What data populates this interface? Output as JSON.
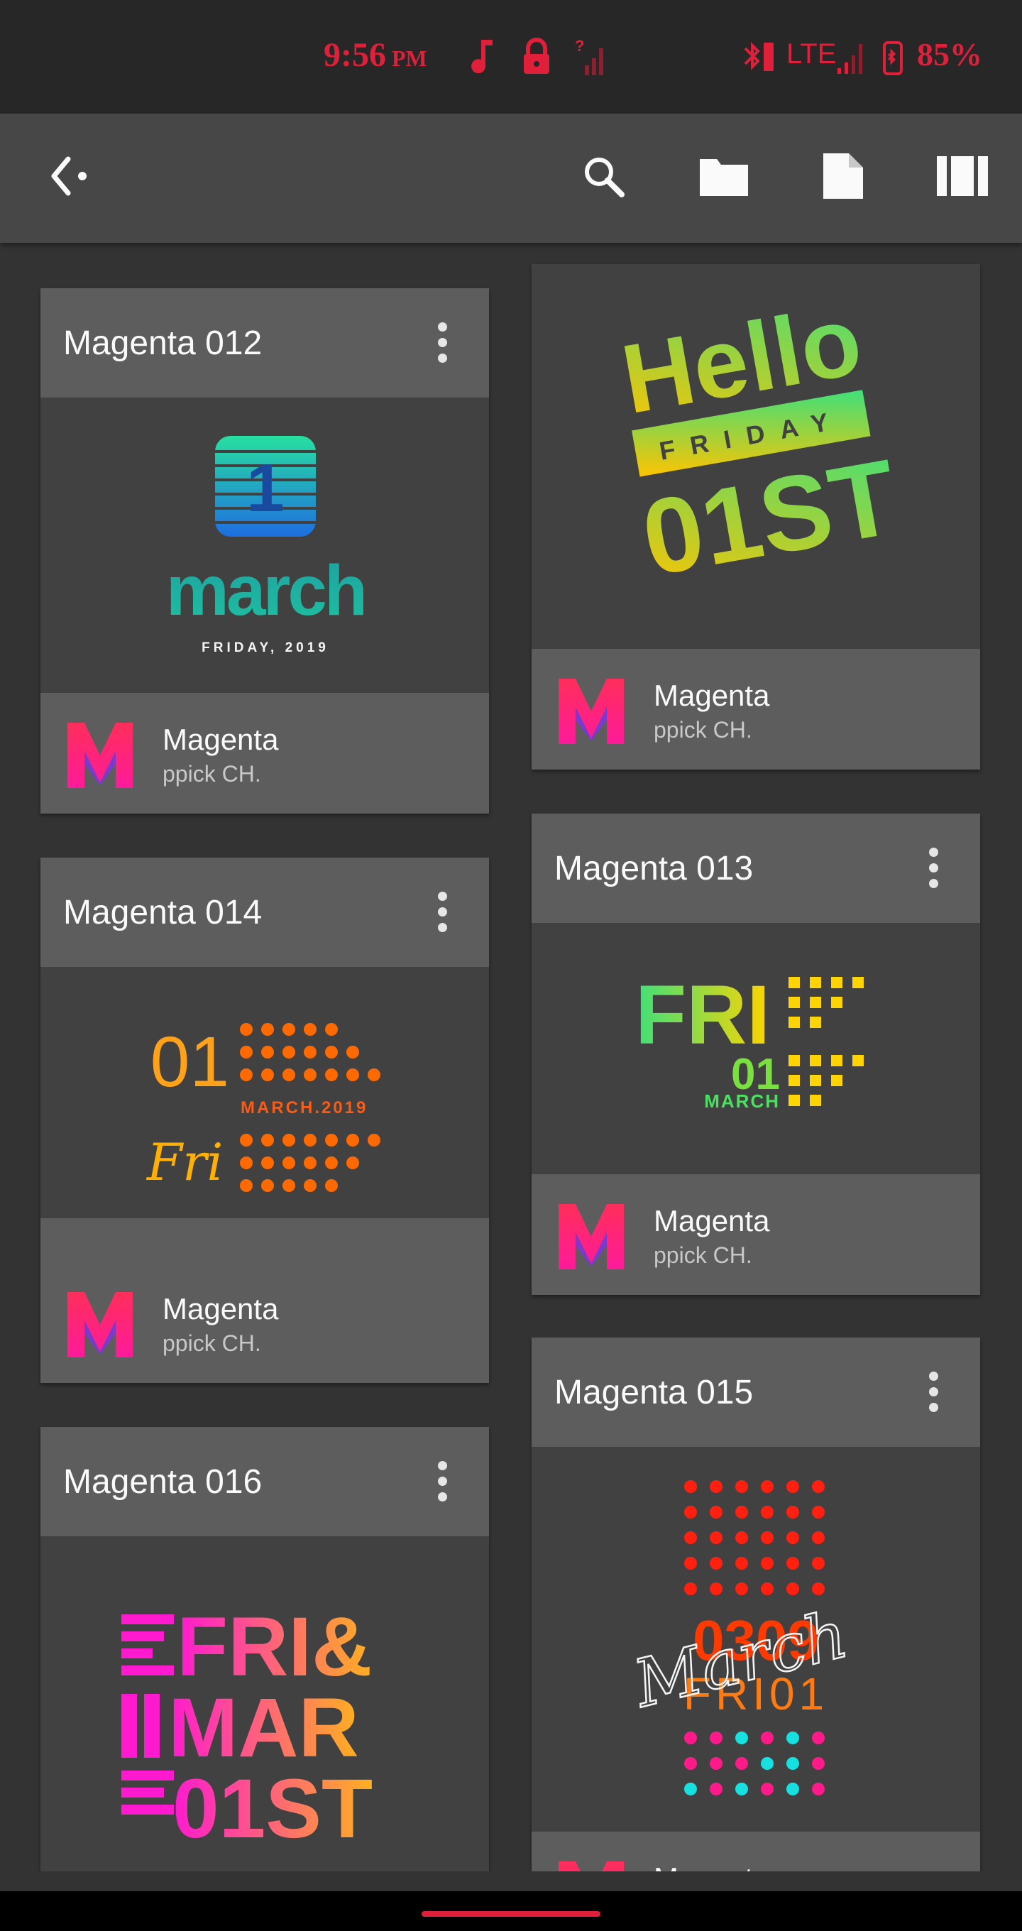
{
  "status_bar": {
    "time": "9:56",
    "ampm": "PM",
    "network": "LTE",
    "battery": "85%"
  },
  "toolbar": {
    "icons": [
      "back-icon",
      "search-icon",
      "folder-icon",
      "file-icon",
      "columns-icon"
    ]
  },
  "cards": [
    {
      "title": "Magenta 012",
      "author": "Magenta",
      "publisher": "ppick CH.",
      "art": {
        "day": "1",
        "month": "march",
        "line": "FRIDAY, 2019"
      }
    },
    {
      "title": "",
      "author": "Magenta",
      "publisher": "ppick CH.",
      "art": {
        "l1": "Hello",
        "l2": "FRIDAY",
        "l3": "01ST"
      }
    },
    {
      "title": "Magenta 014",
      "author": "Magenta",
      "publisher": "ppick CH.",
      "art": {
        "num": "01",
        "date": "MARCH.2019",
        "day": "Fri"
      }
    },
    {
      "title": "Magenta 013",
      "author": "Magenta",
      "publisher": "ppick CH.",
      "art": {
        "day": "FRI",
        "num": "01",
        "month": "MARCH"
      }
    },
    {
      "title": "Magenta 016",
      "art": {
        "l1": "FRI&",
        "l2": "MAR",
        "l3": "01ST"
      }
    },
    {
      "title": "Magenta 015",
      "author": "Magenta",
      "art": {
        "num": "0309",
        "script": "March",
        "day": "FRI01"
      }
    }
  ],
  "colors": {
    "accent": "#e0203a",
    "background": "#333333",
    "card": "#5d5d5d",
    "image_bg": "#414141"
  }
}
